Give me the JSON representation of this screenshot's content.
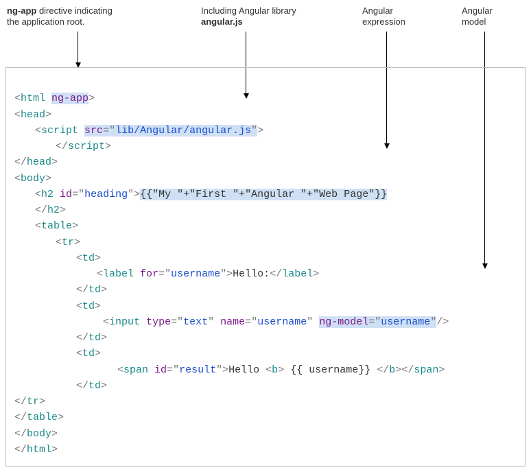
{
  "annotations": {
    "a1_line1": "ng-app",
    "a1_line2": " directive indicating",
    "a1_line3": "the application root.",
    "a2_line1": "Including Angular library",
    "a2_line2": "angular.js",
    "a3_line1": "Angular",
    "a3_line2": "expression",
    "a4_line1": "Angular",
    "a4_line2": "model"
  },
  "code": {
    "html_open_lt": "<",
    "html_tag": "html",
    "ng_app": "ng-app",
    "gt": ">",
    "head_tag": "head",
    "script_tag": "script",
    "src_attr": "src",
    "eq": "=",
    "q": "\"",
    "src_val": "lib/Angular/angular.js",
    "close_slash": "/",
    "body_tag": "body",
    "h2_tag": "h2",
    "id_attr": "id",
    "heading_val": "heading",
    "expr": "{{\"My \"+\"First \"+\"Angular \"+\"Web Page\"}}",
    "table_tag": "table",
    "tr_tag": "tr",
    "td_tag": "td",
    "label_tag": "label",
    "for_attr": "for",
    "username_val": "username",
    "hello_colon": "Hello:",
    "input_tag": "input",
    "type_attr": "type",
    "text_val": "text",
    "name_attr": "name",
    "ng_model_attr": "ng-model",
    "slash_gt": "/>",
    "span_tag": "span",
    "result_val": "result",
    "hello_sp": "Hello ",
    "b_tag": "b",
    "username_expr": " {{ username}} "
  }
}
